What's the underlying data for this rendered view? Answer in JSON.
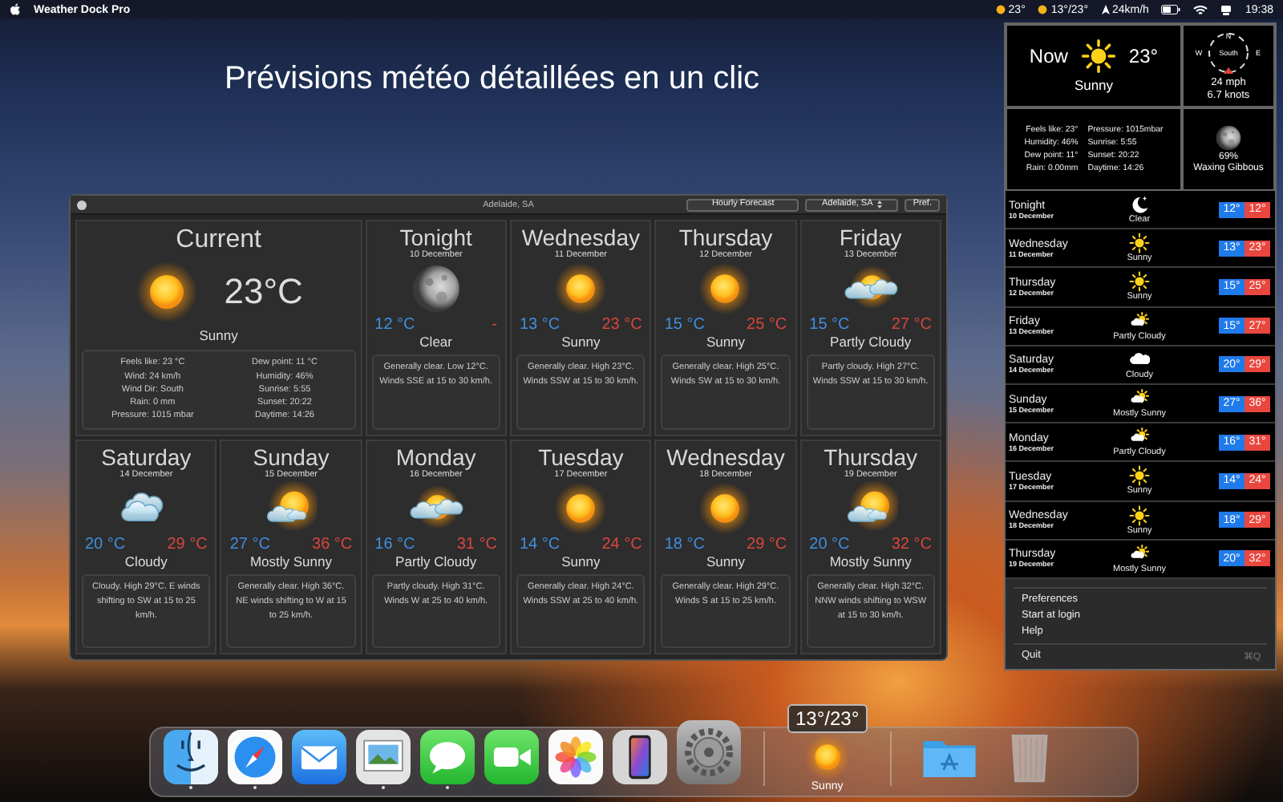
{
  "menu_bar": {
    "app_name": "Weather Dock Pro",
    "status": [
      {
        "kind": "sun",
        "text": "23°"
      },
      {
        "kind": "sun",
        "text": "13°/23°"
      },
      {
        "kind": "wind",
        "text": "24km/h"
      }
    ],
    "clock": "19:38"
  },
  "headline": "Prévisions météo détaillées en un clic",
  "window": {
    "title": "Adelaide, SA",
    "hourly_button": "Hourly Forecast",
    "location_select": "Adelaide, SA",
    "pref_button": "Pref.",
    "current": {
      "heading": "Current",
      "temp": "23°C",
      "condition": "Sunny",
      "kind": "sunny",
      "details": [
        "Feels like: 23 °C",
        "Dew point: 11 °C",
        "Wind: 24 km/h",
        "Humidity: 46%",
        "Wind Dir: South",
        "Sunrise: 5:55",
        "Rain: 0 mm",
        "Sunset: 20:22",
        "Pressure: 1015 mbar",
        "Daytime: 14:26"
      ]
    },
    "days": [
      {
        "day": "Tonight",
        "date": "10 December",
        "low": "12 °C",
        "high": "-",
        "condition": "Clear",
        "kind": "moon",
        "summary": "Generally clear. Low 12°C. Winds SSE at 15 to 30 km/h."
      },
      {
        "day": "Wednesday",
        "date": "11 December",
        "low": "13 °C",
        "high": "23 °C",
        "condition": "Sunny",
        "kind": "sunny",
        "summary": "Generally clear. High 23°C. Winds SSW at 15 to 30 km/h."
      },
      {
        "day": "Thursday",
        "date": "12 December",
        "low": "15 °C",
        "high": "25 °C",
        "condition": "Sunny",
        "kind": "sunny",
        "summary": "Generally clear. High 25°C. Winds SW at 15 to 30 km/h."
      },
      {
        "day": "Friday",
        "date": "13 December",
        "low": "15 °C",
        "high": "27 °C",
        "condition": "Partly Cloudy",
        "kind": "partly",
        "summary": "Partly cloudy. High 27°C. Winds SSW at 15 to 30 km/h."
      },
      {
        "day": "Saturday",
        "date": "14 December",
        "low": "20 °C",
        "high": "29 °C",
        "condition": "Cloudy",
        "kind": "cloudy",
        "summary": "Cloudy. High 29°C. E winds shifting to SW at 15 to 25 km/h."
      },
      {
        "day": "Sunday",
        "date": "15 December",
        "low": "27 °C",
        "high": "36 °C",
        "condition": "Mostly Sunny",
        "kind": "mostly",
        "summary": "Generally clear. High 36°C. NE winds shifting to W at 15 to 25 km/h."
      },
      {
        "day": "Monday",
        "date": "16 December",
        "low": "16 °C",
        "high": "31 °C",
        "condition": "Partly Cloudy",
        "kind": "partly",
        "summary": "Partly cloudy. High 31°C. Winds W at 25 to 40 km/h."
      },
      {
        "day": "Tuesday",
        "date": "17 December",
        "low": "14 °C",
        "high": "24 °C",
        "condition": "Sunny",
        "kind": "sunny",
        "summary": "Generally clear. High 24°C. Winds SSW at 25 to 40 km/h."
      },
      {
        "day": "Wednesday",
        "date": "18 December",
        "low": "18 °C",
        "high": "29 °C",
        "condition": "Sunny",
        "kind": "sunny",
        "summary": "Generally clear. High 29°C. Winds S at 15 to 25 km/h."
      },
      {
        "day": "Thursday",
        "date": "19 December",
        "low": "20 °C",
        "high": "32 °C",
        "condition": "Mostly Sunny",
        "kind": "mostly",
        "summary": "Generally clear. High 32°C. NNW winds shifting to WSW at 15 to 30 km/h."
      }
    ]
  },
  "panel": {
    "now": {
      "label": "Now",
      "temp": "23°",
      "condition": "Sunny",
      "kind": "sunny"
    },
    "wind": {
      "north": "N",
      "west": "W",
      "direction": "South",
      "east": "E",
      "speed": "24 mph",
      "knots": "6.7 knots"
    },
    "details": [
      "Feels like: 23°",
      "Pressure: 1015mbar",
      "Humidity: 46%",
      "Sunrise: 5:55",
      "Dew point: 11°",
      "Sunset: 20:22",
      "Rain: 0.00mm",
      "Daytime: 14:26"
    ],
    "moon": {
      "percent": "69%",
      "phase": "Waxing Gibbous"
    },
    "forecast": [
      {
        "day": "Tonight",
        "date": "10 December",
        "condition": "Clear",
        "kind": "moon",
        "low": "12°",
        "high": "12°"
      },
      {
        "day": "Wednesday",
        "date": "11 December",
        "condition": "Sunny",
        "kind": "sunny",
        "low": "13°",
        "high": "23°"
      },
      {
        "day": "Thursday",
        "date": "12 December",
        "condition": "Sunny",
        "kind": "sunny",
        "low": "15°",
        "high": "25°"
      },
      {
        "day": "Friday",
        "date": "13 December",
        "condition": "Partly Cloudy",
        "kind": "partly",
        "low": "15°",
        "high": "27°"
      },
      {
        "day": "Saturday",
        "date": "14 December",
        "condition": "Cloudy",
        "kind": "cloudy",
        "low": "20°",
        "high": "29°"
      },
      {
        "day": "Sunday",
        "date": "15 December",
        "condition": "Mostly Sunny",
        "kind": "mostly",
        "low": "27°",
        "high": "36°"
      },
      {
        "day": "Monday",
        "date": "16 December",
        "condition": "Partly Cloudy",
        "kind": "partly",
        "low": "16°",
        "high": "31°"
      },
      {
        "day": "Tuesday",
        "date": "17 December",
        "condition": "Sunny",
        "kind": "sunny",
        "low": "14°",
        "high": "24°"
      },
      {
        "day": "Wednesday",
        "date": "18 December",
        "condition": "Sunny",
        "kind": "sunny",
        "low": "18°",
        "high": "29°"
      },
      {
        "day": "Thursday",
        "date": "19 December",
        "condition": "Mostly Sunny",
        "kind": "mostly",
        "low": "20°",
        "high": "32°"
      }
    ],
    "menu": [
      {
        "label": "Preferences"
      },
      {
        "label": "Start at login"
      },
      {
        "label": "Help"
      },
      {
        "label": "Quit",
        "shortcut": "⌘Q"
      }
    ]
  },
  "dock": {
    "apps": [
      {
        "kind": "finder",
        "running": true
      },
      {
        "kind": "safari",
        "running": true
      },
      {
        "kind": "mail",
        "running": false
      },
      {
        "kind": "preview",
        "running": true
      },
      {
        "kind": "messages",
        "running": true
      },
      {
        "kind": "facetime",
        "running": false
      },
      {
        "kind": "photos",
        "running": false
      },
      {
        "kind": "phone",
        "running": false
      },
      {
        "kind": "settings",
        "running": false
      }
    ],
    "weather": {
      "temps": "13°/23°",
      "condition": "Sunny",
      "kind": "sunny"
    },
    "tail": [
      {
        "kind": "folder",
        "running": false
      },
      {
        "kind": "trash",
        "running": false
      }
    ]
  }
}
